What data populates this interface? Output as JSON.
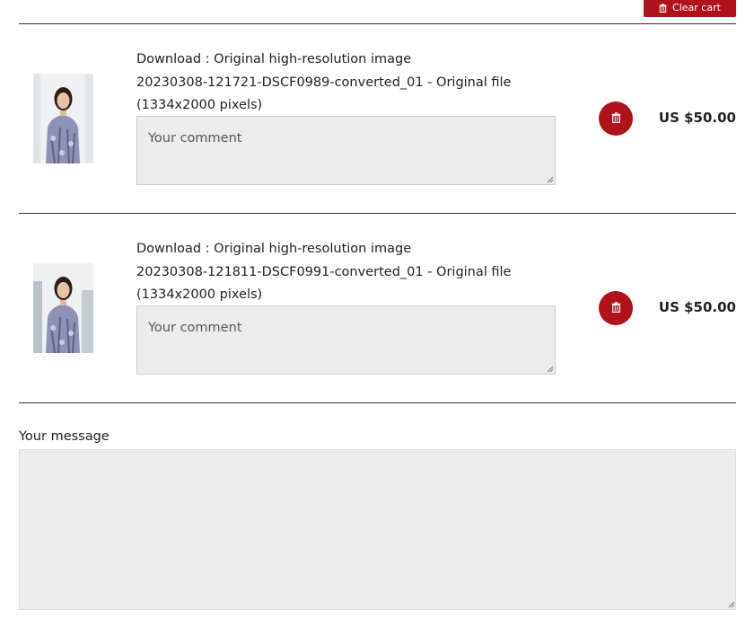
{
  "cart": {
    "clear_label": "Clear cart",
    "accent_color": "#b0121b",
    "items": [
      {
        "description_line1": "Download : Original high-resolution image",
        "description_line2": "20230308-121721-DSCF0989-converted_01 - Original file",
        "description_line3": "(1334x2000 pixels)",
        "comment_placeholder": "Your comment",
        "price": "US $50.00",
        "thumbnail_icon": "portrait-photo",
        "delete_icon": "trash-icon"
      },
      {
        "description_line1": "Download : Original high-resolution image",
        "description_line2": "20230308-121811-DSCF0991-converted_01 - Original file",
        "description_line3": "(1334x2000 pixels)",
        "comment_placeholder": "Your comment",
        "price": "US $50.00",
        "thumbnail_icon": "portrait-photo",
        "delete_icon": "trash-icon"
      }
    ]
  },
  "message": {
    "label": "Your message",
    "value": ""
  }
}
